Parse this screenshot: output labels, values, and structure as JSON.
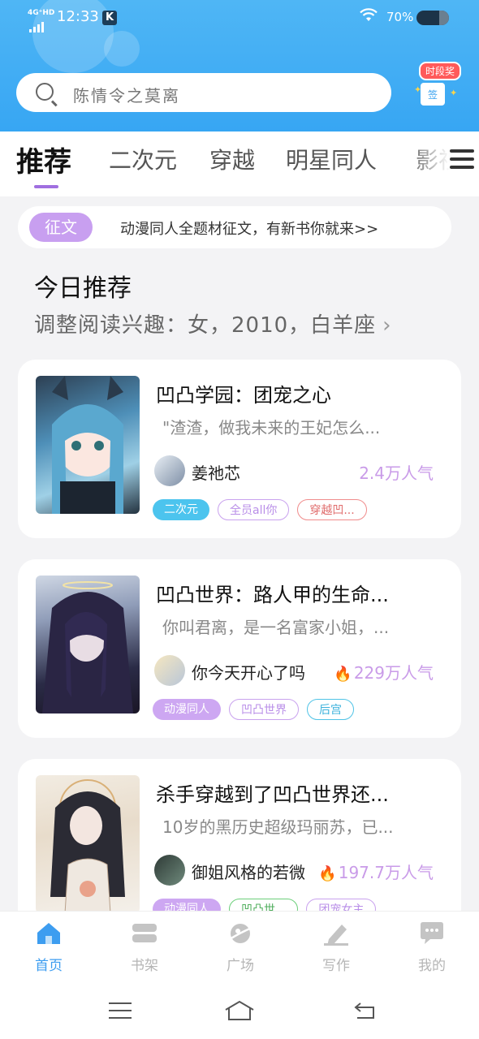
{
  "status_bar": {
    "network": "4G⁺HD",
    "time": "12:33",
    "app_badge": "K",
    "battery_text": "70%",
    "battery_level": 0.7
  },
  "search": {
    "placeholder": "陈情令之莫离"
  },
  "signin": {
    "badge": "时段奖",
    "box_label": "签"
  },
  "tabs": [
    "推荐",
    "二次元",
    "穿越",
    "明星同人",
    "影视"
  ],
  "notice": {
    "chip": "征文",
    "message": "动漫同人全题材征文，有新书你就来>>"
  },
  "section": {
    "title": "今日推荐",
    "subtitle": "调整阅读兴趣：女，2010，白羊座",
    "chevron": "›"
  },
  "books": [
    {
      "title": "凹凸学园：团宠之心",
      "desc": "\"渣渣，做我未来的王妃怎么...",
      "author": "姜祂芯",
      "popularity": "2.4万人气",
      "tags": [
        "二次元",
        "全员all你",
        "穿越凹..."
      ]
    },
    {
      "title": "凹凸世界：路人甲的生命...",
      "desc": "你叫君离，是一名富家小姐，...",
      "author": "你今天开心了吗",
      "popularity": "229万人气",
      "tags": [
        "动漫同人",
        "凹凸世界",
        "后宫"
      ]
    },
    {
      "title": "杀手穿越到了凹凸世界还...",
      "desc": "10岁的黑历史超级玛丽苏，已...",
      "author": "御姐风格的若微",
      "popularity": "197.7万人气",
      "tags": [
        "动漫同人",
        "凹凸世...",
        "团宠女主"
      ]
    }
  ],
  "bottom_nav": [
    "首页",
    "书架",
    "广场",
    "写作",
    "我的"
  ],
  "colors": {
    "header": "#3aa8f3",
    "accent_purple": "#c89ff0",
    "active_nav": "#3d9df0"
  }
}
